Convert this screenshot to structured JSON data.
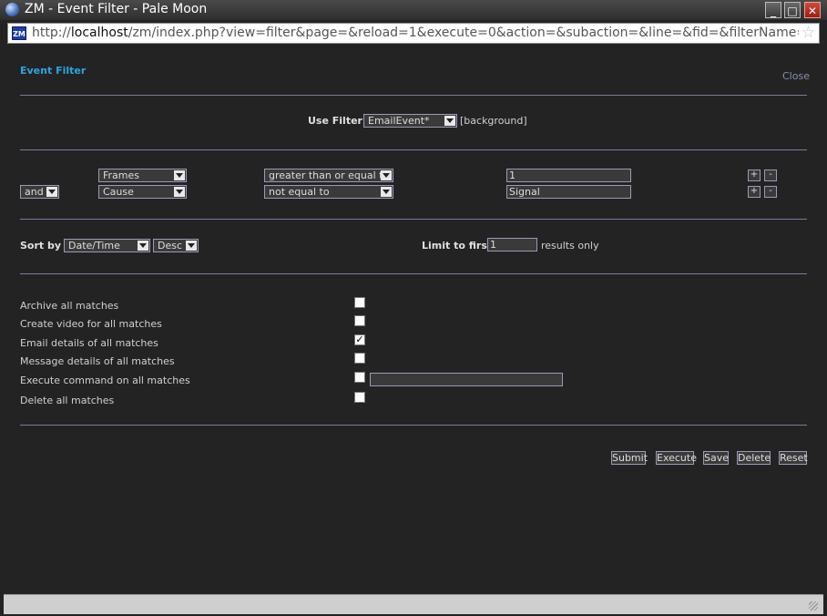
{
  "window": {
    "title": "ZM - Event Filter - Pale Moon",
    "controls": {
      "minimize": "_",
      "maximize": "□",
      "close": "✕"
    },
    "url_scheme": "http://",
    "url_host": "localhost",
    "url_path": "/zm/index.php?view=filter&page=&reload=1&execute=0&action=&subaction=&line=&fid=&filterName=EmailEv",
    "zm_icon": "ZM"
  },
  "header": {
    "title": "Event Filter",
    "close_label": "Close"
  },
  "use_filter": {
    "label": "Use Filter",
    "selected": "EmailEvent*",
    "suffix": "[background]"
  },
  "terms": [
    {
      "conjunction": "",
      "attribute": "Frames",
      "operator": "greater than or equal to",
      "value": "1"
    },
    {
      "conjunction": "and",
      "attribute": "Cause",
      "operator": "not equal to",
      "value": "Signal"
    }
  ],
  "term_buttons": {
    "add": "+",
    "remove": "-"
  },
  "sort": {
    "label": "Sort by",
    "field": "Date/Time",
    "direction": "Desc"
  },
  "limit": {
    "label": "Limit to first",
    "value": "1",
    "suffix": "results only"
  },
  "actions": [
    {
      "label": "Archive all matches",
      "checked": false
    },
    {
      "label": "Create video for all matches",
      "checked": false
    },
    {
      "label": "Email details of all matches",
      "checked": true
    },
    {
      "label": "Message details of all matches",
      "checked": false
    },
    {
      "label": "Execute command on all matches",
      "checked": false,
      "command": ""
    },
    {
      "label": "Delete all matches",
      "checked": false
    }
  ],
  "buttons": {
    "submit": "Submit",
    "execute": "Execute",
    "save": "Save",
    "delete": "Delete",
    "reset": "Reset"
  }
}
